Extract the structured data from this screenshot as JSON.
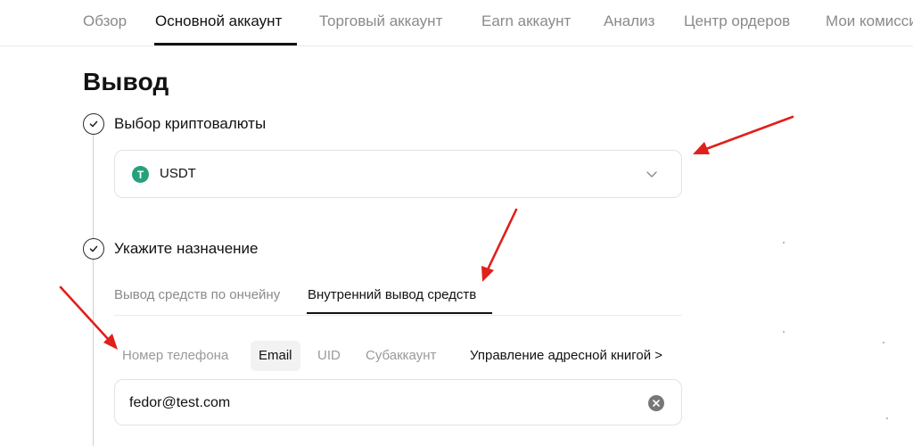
{
  "top_tabs": [
    {
      "label": "Обзор",
      "active": false
    },
    {
      "label": "Основной аккаунт",
      "active": true
    },
    {
      "label": "Торговый аккаунт",
      "active": false
    },
    {
      "label": "Earn аккаунт",
      "active": false
    },
    {
      "label": "Анализ",
      "active": false
    },
    {
      "label": "Центр ордеров",
      "active": false
    },
    {
      "label": "Мои комиссии",
      "active": false
    }
  ],
  "page_title": "Вывод",
  "steps": [
    {
      "label": "Выбор криптовалюты",
      "completed": true
    },
    {
      "label": "Укажите назначение",
      "completed": true
    }
  ],
  "crypto": {
    "icon_letter": "T",
    "icon_name": "usdt-tether-icon",
    "icon_color": "#26a17b",
    "selected": "USDT"
  },
  "destination_tabs": [
    {
      "label": "Вывод средств по ончейну",
      "active": false
    },
    {
      "label": "Внутренний вывод средств",
      "active": true
    }
  ],
  "methods": [
    {
      "label": "Номер телефона",
      "active": false
    },
    {
      "label": "Email",
      "active": true
    },
    {
      "label": "UID",
      "active": false
    },
    {
      "label": "Субаккаунт",
      "active": false
    }
  ],
  "address_book": "Управление адресной книгой >",
  "email_value": "fedor@test.com",
  "annotation_color": "#e0201b"
}
